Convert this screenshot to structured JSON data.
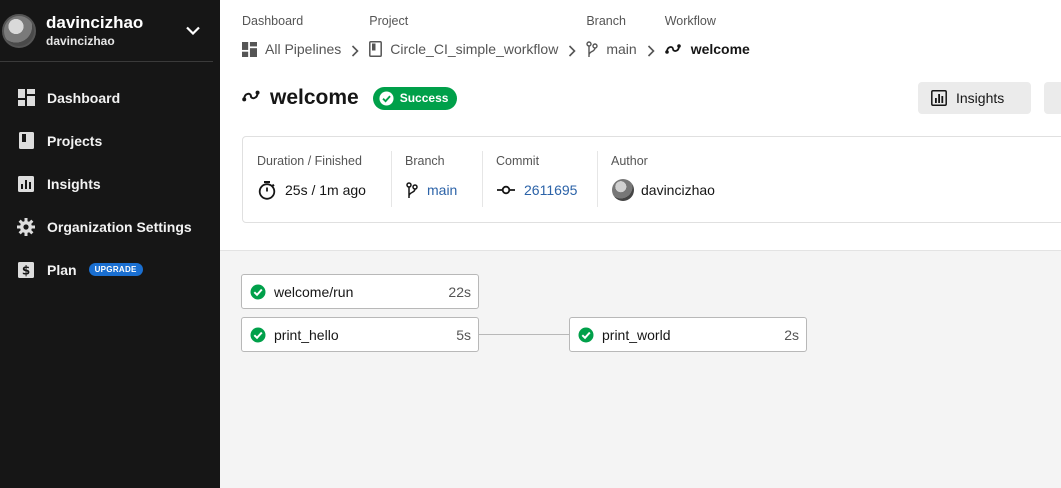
{
  "sidebar": {
    "user_name": "davincizhao",
    "user_sub": "davincizhao",
    "items": [
      {
        "label": "Dashboard",
        "icon": "dashboard-icon"
      },
      {
        "label": "Projects",
        "icon": "projects-icon"
      },
      {
        "label": "Insights",
        "icon": "insights-icon"
      },
      {
        "label": "Organization Settings",
        "icon": "gear-icon"
      },
      {
        "label": "Plan",
        "icon": "dollar-icon",
        "badge": "UPGRADE"
      }
    ]
  },
  "breadcrumb": [
    {
      "head": "Dashboard",
      "value": "All Pipelines",
      "icon": "pipelines-icon"
    },
    {
      "head": "Project",
      "value": "Circle_CI_simple_workflow",
      "icon": "project-icon"
    },
    {
      "head": "Branch",
      "value": "main",
      "icon": "branch-icon"
    },
    {
      "head": "Workflow",
      "value": "welcome",
      "icon": "workflow-icon"
    }
  ],
  "workflow": {
    "title": "welcome",
    "status": "Success",
    "insights_label": "Insights"
  },
  "info": {
    "duration_head": "Duration / Finished",
    "duration_value": "25s / 1m ago",
    "branch_head": "Branch",
    "branch_value": "main",
    "commit_head": "Commit",
    "commit_value": "2611695",
    "author_head": "Author",
    "author_value": "davincizhao"
  },
  "jobs": [
    {
      "name": "welcome/run",
      "duration": "22s"
    },
    {
      "name": "print_hello",
      "duration": "5s"
    },
    {
      "name": "print_world",
      "duration": "2s"
    }
  ],
  "colors": {
    "sidebar_bg": "#161616",
    "success": "#00a04a",
    "link": "#2c63a8",
    "upgrade_badge": "#1a6fd1"
  }
}
